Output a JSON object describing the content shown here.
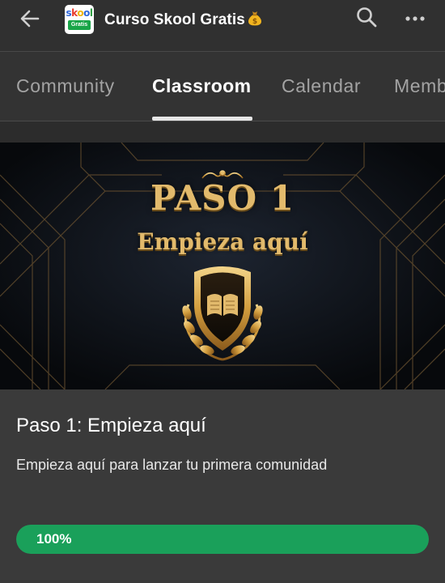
{
  "appbar": {
    "title": "Curso Skool Gratis",
    "title_emoji_icon": "money-bag-icon",
    "logo": {
      "word": "skool",
      "badge": "Gratis"
    },
    "back_icon": "arrow-left-icon",
    "search_icon": "search-icon",
    "more_icon": "more-horizontal-icon"
  },
  "tabs": [
    {
      "label": "Community",
      "active": false
    },
    {
      "label": "Classroom",
      "active": true
    },
    {
      "label": "Calendar",
      "active": false
    },
    {
      "label": "Memb",
      "active": false
    }
  ],
  "banner": {
    "title": "PASO 1",
    "subtitle": "Empieza aquí",
    "emblem_icon": "shield-book-laurel-icon"
  },
  "course": {
    "title": "Paso 1: Empieza aquí",
    "description": "Empieza aquí para lanzar tu primera comunidad",
    "progress_percent": 100,
    "progress_label": "100%"
  },
  "colors": {
    "progress": "#1aa05a",
    "gold": "#e2ba6c",
    "background": "#3a3a3a"
  }
}
